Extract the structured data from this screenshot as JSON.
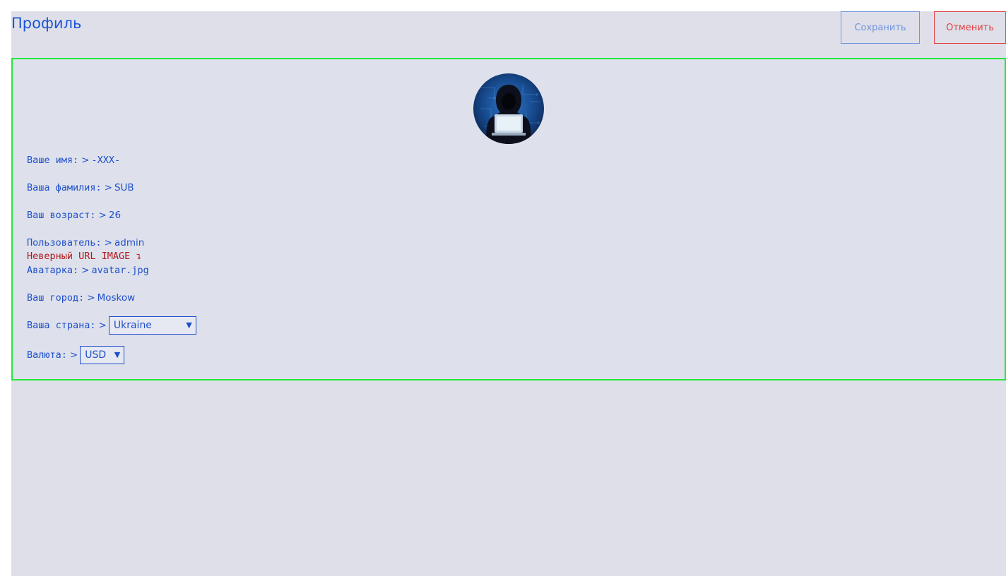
{
  "header": {
    "title": "Профиль",
    "save_label": "Сохранить",
    "cancel_label": "Отменить"
  },
  "colors": {
    "accent": "#1f4fc9",
    "title": "#1a56d6",
    "save_button": "#6f95e0",
    "cancel_button": "#e04040",
    "card_border": "#21e83a",
    "error": "#b01818",
    "background": "#dfdfe9"
  },
  "profile": {
    "avatar_icon": "hooded-hacker-avatar",
    "arrow": ">",
    "name": {
      "label": "Ваше имя:",
      "value": "-XXX-"
    },
    "surname": {
      "label": "Ваша фамилия:",
      "value": "SUB"
    },
    "age": {
      "label": "Ваш возраст:",
      "value": "26"
    },
    "user": {
      "label": "Пользователь:",
      "value": "admin"
    },
    "image_error": "Неверный URL IMAGE ↴",
    "avatar_file": {
      "label": "Аватарка:",
      "value": "avatar.jpg"
    },
    "city": {
      "label": "Ваш город:",
      "value": "Moskow"
    },
    "country": {
      "label": "Ваша страна:",
      "selected": "Ukraine"
    },
    "currency": {
      "label": "Валюта:",
      "selected": "USD"
    }
  }
}
